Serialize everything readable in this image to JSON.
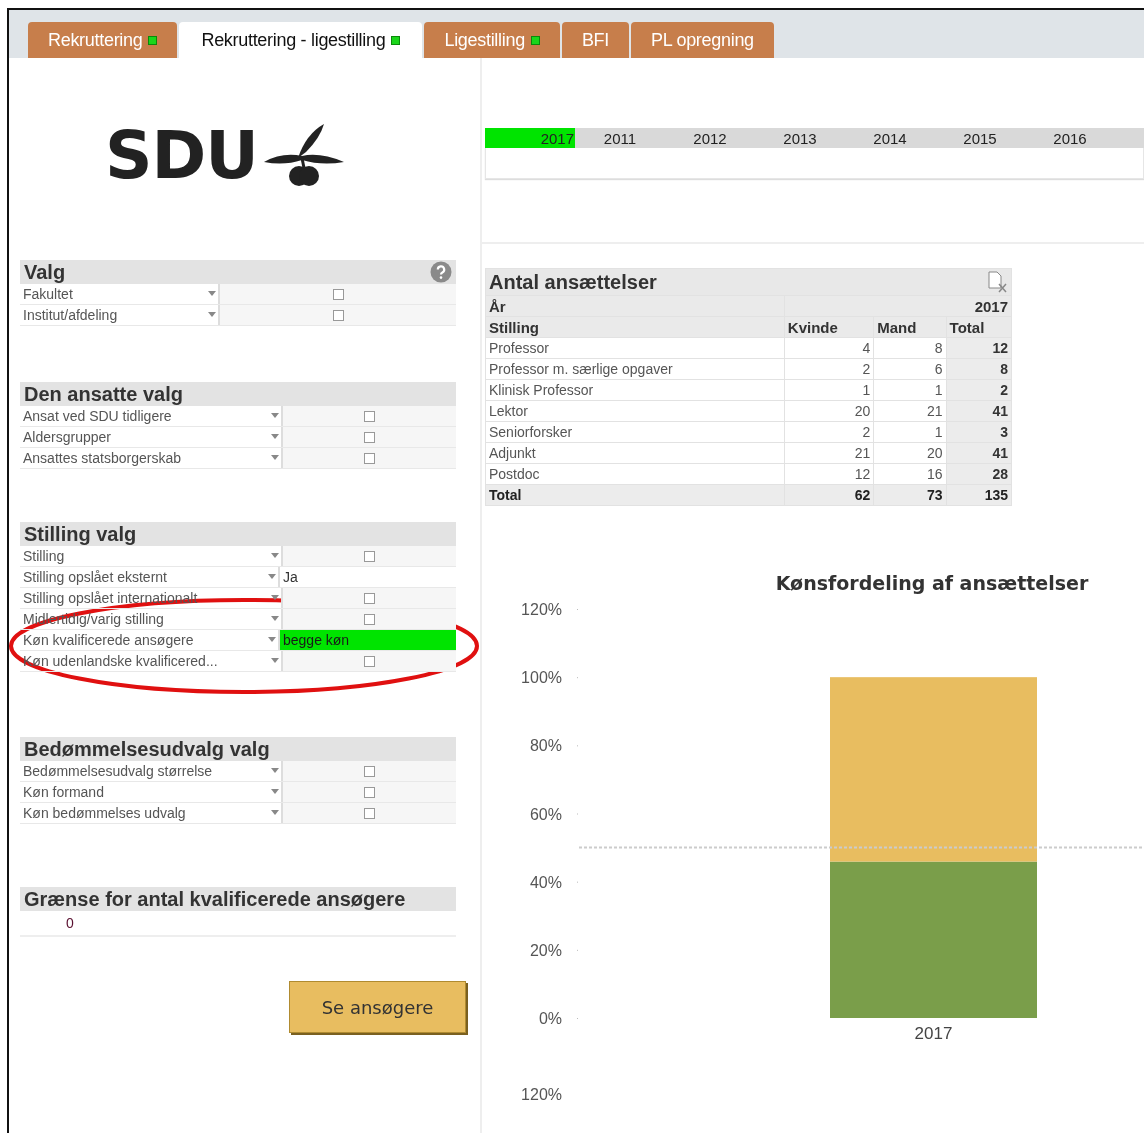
{
  "tabs": [
    {
      "label": "Rekruttering",
      "selected": false,
      "indicator": true
    },
    {
      "label": "Rekruttering - ligestilling",
      "selected": true,
      "indicator": true
    },
    {
      "label": "Ligestilling",
      "selected": false,
      "indicator": true
    },
    {
      "label": "BFI",
      "selected": false,
      "indicator": false
    },
    {
      "label": "PL opregning",
      "selected": false,
      "indicator": false
    }
  ],
  "logo": {
    "text": "SDU"
  },
  "years": [
    {
      "label": "2017",
      "selected": true
    },
    {
      "label": "2011",
      "selected": false
    },
    {
      "label": "2012",
      "selected": false
    },
    {
      "label": "2013",
      "selected": false
    },
    {
      "label": "2014",
      "selected": false
    },
    {
      "label": "2015",
      "selected": false
    },
    {
      "label": "2016",
      "selected": false
    }
  ],
  "filter_panels": [
    {
      "title": "Valg",
      "help": true,
      "items": [
        {
          "label": "Fakultet",
          "selected": false
        },
        {
          "label": "Institut/afdeling",
          "selected": false
        }
      ]
    },
    {
      "title": "Den ansatte valg",
      "help": false,
      "items": [
        {
          "label": "Ansat ved SDU tidligere",
          "selected": false
        },
        {
          "label": "Aldersgrupper",
          "selected": false
        },
        {
          "label": "Ansattes statsborgerskab",
          "selected": false
        }
      ]
    },
    {
      "title": "Stilling valg",
      "help": false,
      "items": [
        {
          "label": "Stilling",
          "selected": false
        },
        {
          "label": "Stilling opslået eksternt",
          "value": "Ja",
          "selected": false
        },
        {
          "label": "Stilling opslået internationalt",
          "selected": false
        },
        {
          "label": "Midlertidig/varig stilling",
          "selected": false
        },
        {
          "label": "Køn kvalificerede ansøgere",
          "value": "begge køn",
          "selected": true
        },
        {
          "label": "Køn udenlandske kvalificered...",
          "selected": false
        }
      ]
    },
    {
      "title": "Bedømmelsesudvalg valg",
      "help": false,
      "items": [
        {
          "label": "Bedømmelsesudvalg størrelse",
          "selected": false
        },
        {
          "label": "Køn formand",
          "selected": false
        },
        {
          "label": "Køn bedømmelses udvalg",
          "selected": false
        }
      ]
    }
  ],
  "limit_panel": {
    "title": "Grænse for antal kvalificerede ansøgere",
    "value": "0"
  },
  "button": {
    "label": "Se ansøgere"
  },
  "table": {
    "title": "Antal ansættelser",
    "year_label": "År",
    "year": "2017",
    "columns": [
      "Stilling",
      "Kvinde",
      "Mand",
      "Total"
    ],
    "rows": [
      [
        "Professor",
        "4",
        "8",
        "12"
      ],
      [
        "Professor m. særlige opgaver",
        "2",
        "6",
        "8"
      ],
      [
        "Klinisk Professor",
        "1",
        "1",
        "2"
      ],
      [
        "Lektor",
        "20",
        "21",
        "41"
      ],
      [
        "Seniorforsker",
        "2",
        "1",
        "3"
      ],
      [
        "Adjunkt",
        "21",
        "20",
        "41"
      ],
      [
        "Postdoc",
        "12",
        "16",
        "28"
      ]
    ],
    "total": [
      "Total",
      "62",
      "73",
      "135"
    ]
  },
  "chart": {
    "chart_data": {
      "type": "bar",
      "title": "Kønsfordeling af ansættelser",
      "categories": [
        "2017"
      ],
      "stacked": true,
      "series": [
        {
          "color": "#7a9e4a",
          "values": [
            45.9
          ]
        },
        {
          "color": "#e8bd60",
          "values": [
            54.1
          ]
        }
      ],
      "ylim": [
        0,
        120
      ],
      "yticks": [
        {
          "value": 0,
          "label": "0%"
        },
        {
          "value": 20,
          "label": "20%"
        },
        {
          "value": 40,
          "label": "40%"
        },
        {
          "value": 60,
          "label": "60%"
        },
        {
          "value": 80,
          "label": "80%"
        },
        {
          "value": 100,
          "label": "100%"
        },
        {
          "value": 120,
          "label": "120%"
        }
      ],
      "ref_lines": [
        {
          "axis": "y",
          "value": 50
        }
      ]
    },
    "stray_axis_label": "120%"
  },
  "annotation": {
    "kind": "ellipse",
    "color": "#e01010"
  }
}
